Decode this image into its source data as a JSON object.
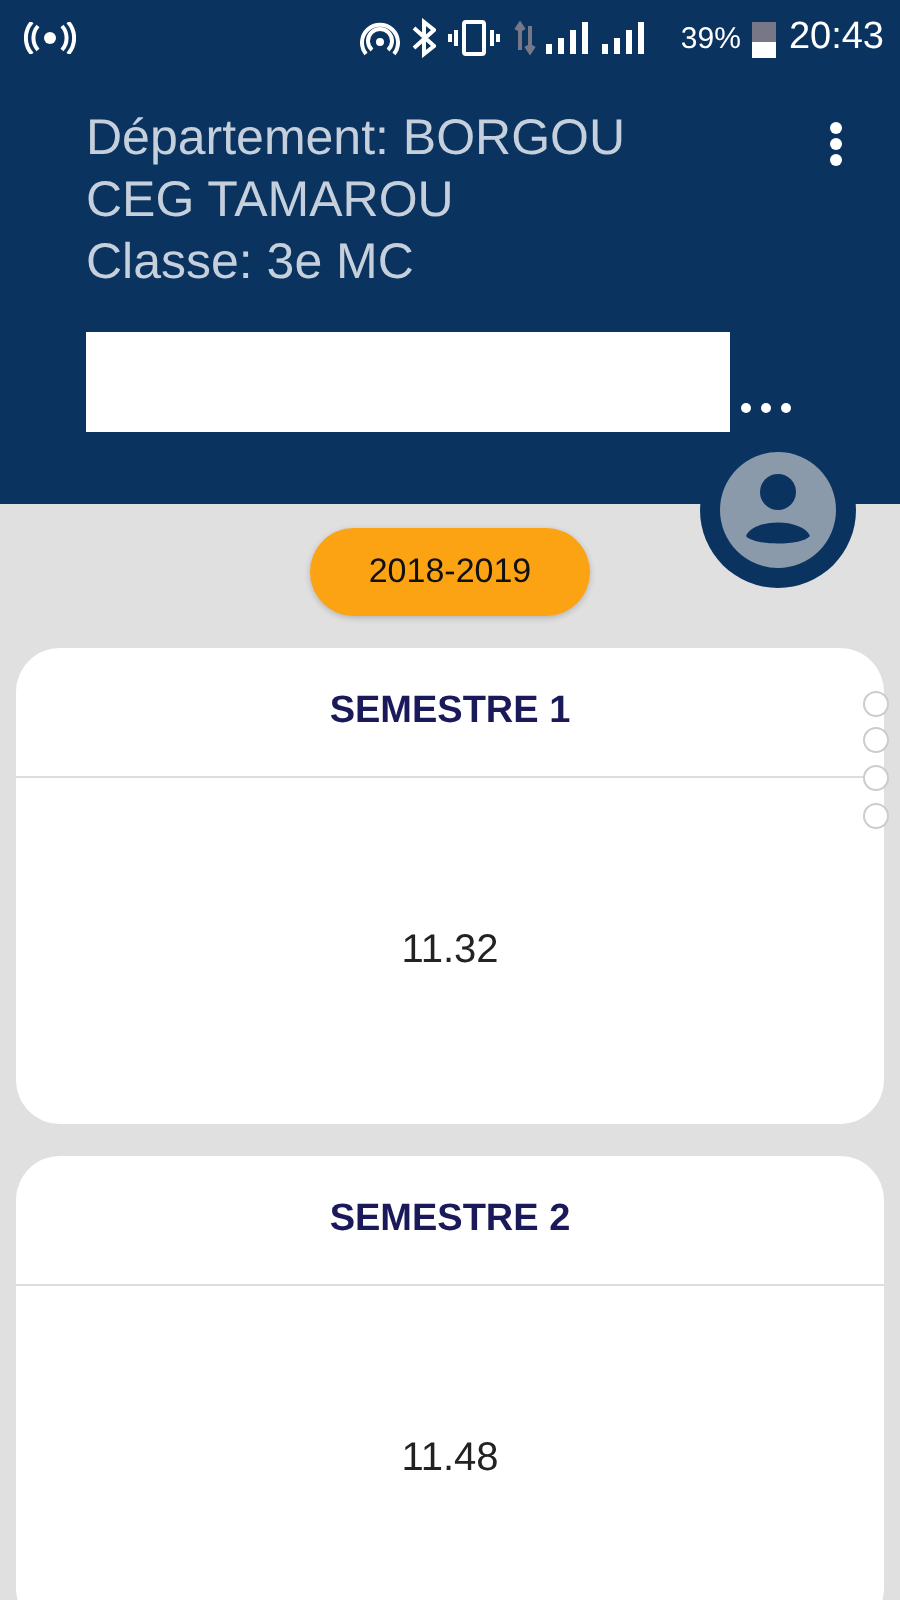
{
  "status_bar": {
    "battery": "39%",
    "time": "20:43"
  },
  "header": {
    "lines": [
      "Département: BORGOU",
      "CEG TAMAROU",
      "Classe: 3e MC"
    ]
  },
  "year_badge": "2018-2019",
  "semesters": [
    {
      "title": "SEMESTRE 1",
      "average": "11.32"
    },
    {
      "title": "SEMESTRE 2",
      "average": "11.48"
    }
  ]
}
